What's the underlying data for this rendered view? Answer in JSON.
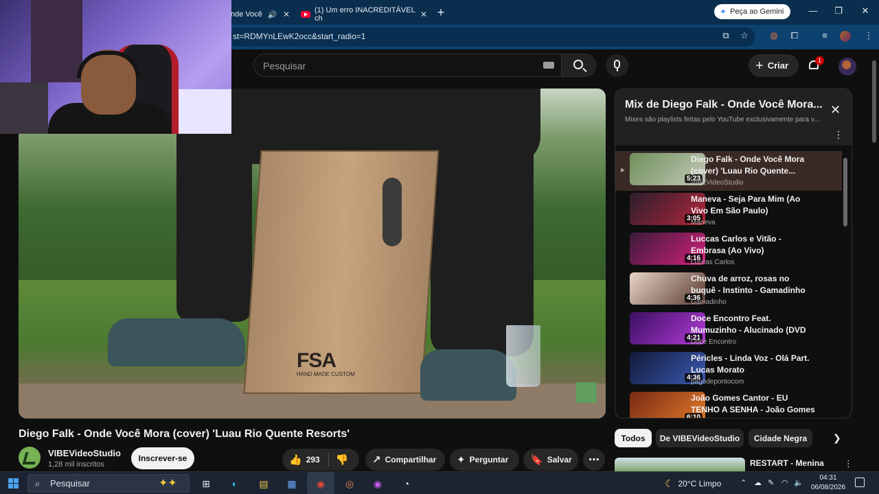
{
  "browser": {
    "tabs": [
      {
        "label": "nde Você",
        "active": true
      },
      {
        "label": "(1) Um erro INACREDITÁVEL ch",
        "active": false
      }
    ],
    "new_tab": "+",
    "gemini_button": "Peça ao Gemini",
    "url": "st=RDMYnLEwK2occ&start_radio=1",
    "window_controls": {
      "minimize": "—",
      "maximize": "❐",
      "close": "✕"
    }
  },
  "youtube_header": {
    "search_placeholder": "Pesquisar",
    "create_label": "Criar",
    "notification_count": "1"
  },
  "video": {
    "title": "Diego Falk - Onde Você Mora (cover) 'Luau Rio Quente Resorts'",
    "channel_name": "VIBEVideoStudio",
    "subscribers": "1,28 mil inscritos",
    "subscribe_label": "Inscrever-se",
    "likes": "293",
    "share_label": "Compartilhar",
    "ask_label": "Perguntar",
    "save_label": "Salvar",
    "player_overlay": {
      "brand": "FSA",
      "brand_sub": "HAND MADE CUSTOM"
    }
  },
  "playlist": {
    "title": "Mix de Diego Falk - Onde Você Mora...",
    "subtitle": "Mixes são playlists feitas pelo YouTube exclusivamente para v...",
    "items": [
      {
        "title": "Diego Falk - Onde Você Mora (cover) 'Luau Rio Quente...",
        "channel": "VIBEVideoStudio",
        "duration": "5:23",
        "active": true,
        "thumb_colors": [
          "#6f8f5a",
          "#c3c9b8"
        ]
      },
      {
        "title": "Maneva - Seja Para Mim (Ao Vivo Em São Paulo)",
        "channel": "Maneva",
        "duration": "3:05",
        "active": false,
        "thumb_colors": [
          "#2a1e2e",
          "#b3263a"
        ]
      },
      {
        "title": "Luccas Carlos e Vitão - Embrasa (Ao Vivo)",
        "channel": "Luccas Carlos",
        "duration": "4:16",
        "active": false,
        "thumb_colors": [
          "#3a1a3a",
          "#d1227a"
        ]
      },
      {
        "title": "Chuva de arroz, rosas no buquê - Instinto - Gamadinho cantando...",
        "channel": "Gamadinho",
        "duration": "4:36",
        "active": false,
        "thumb_colors": [
          "#e8d6c8",
          "#5a3a30"
        ]
      },
      {
        "title": "Doce Encontro Feat. Mumuzinho - Alucinado (DVD Não Se Mete)",
        "channel": "Doce Encontro",
        "duration": "4:21",
        "active": false,
        "thumb_colors": [
          "#3a1060",
          "#b23ad8"
        ]
      },
      {
        "title": "Péricles - Linda Voz - Olá Part. Lucas Morato",
        "channel": "pagodepontocom",
        "duration": "4:36",
        "active": false,
        "thumb_colors": [
          "#121a3a",
          "#3a5ab0"
        ]
      },
      {
        "title": "João Gomes Cantor - EU TENHO A SENHA - João Gomes (DVD...",
        "channel": "",
        "duration": "6:10",
        "active": false,
        "thumb_colors": [
          "#7a2a12",
          "#e07a2a"
        ]
      }
    ]
  },
  "chips": [
    "Todos",
    "De VIBEVideoStudio",
    "Cidade Negra"
  ],
  "recommended": {
    "title": "RESTART - Menina"
  },
  "taskbar": {
    "search_placeholder": "Pesquisar",
    "weather": "20°C  Limpo",
    "time": "04:31",
    "date": "06/08/2026"
  },
  "colors": {
    "brand_red": "#ff0033",
    "background": "#0f0f0f",
    "chrome_tabbar": "#0a2e4d",
    "chrome_address": "#0d4170",
    "taskbar": "#1c2431"
  }
}
